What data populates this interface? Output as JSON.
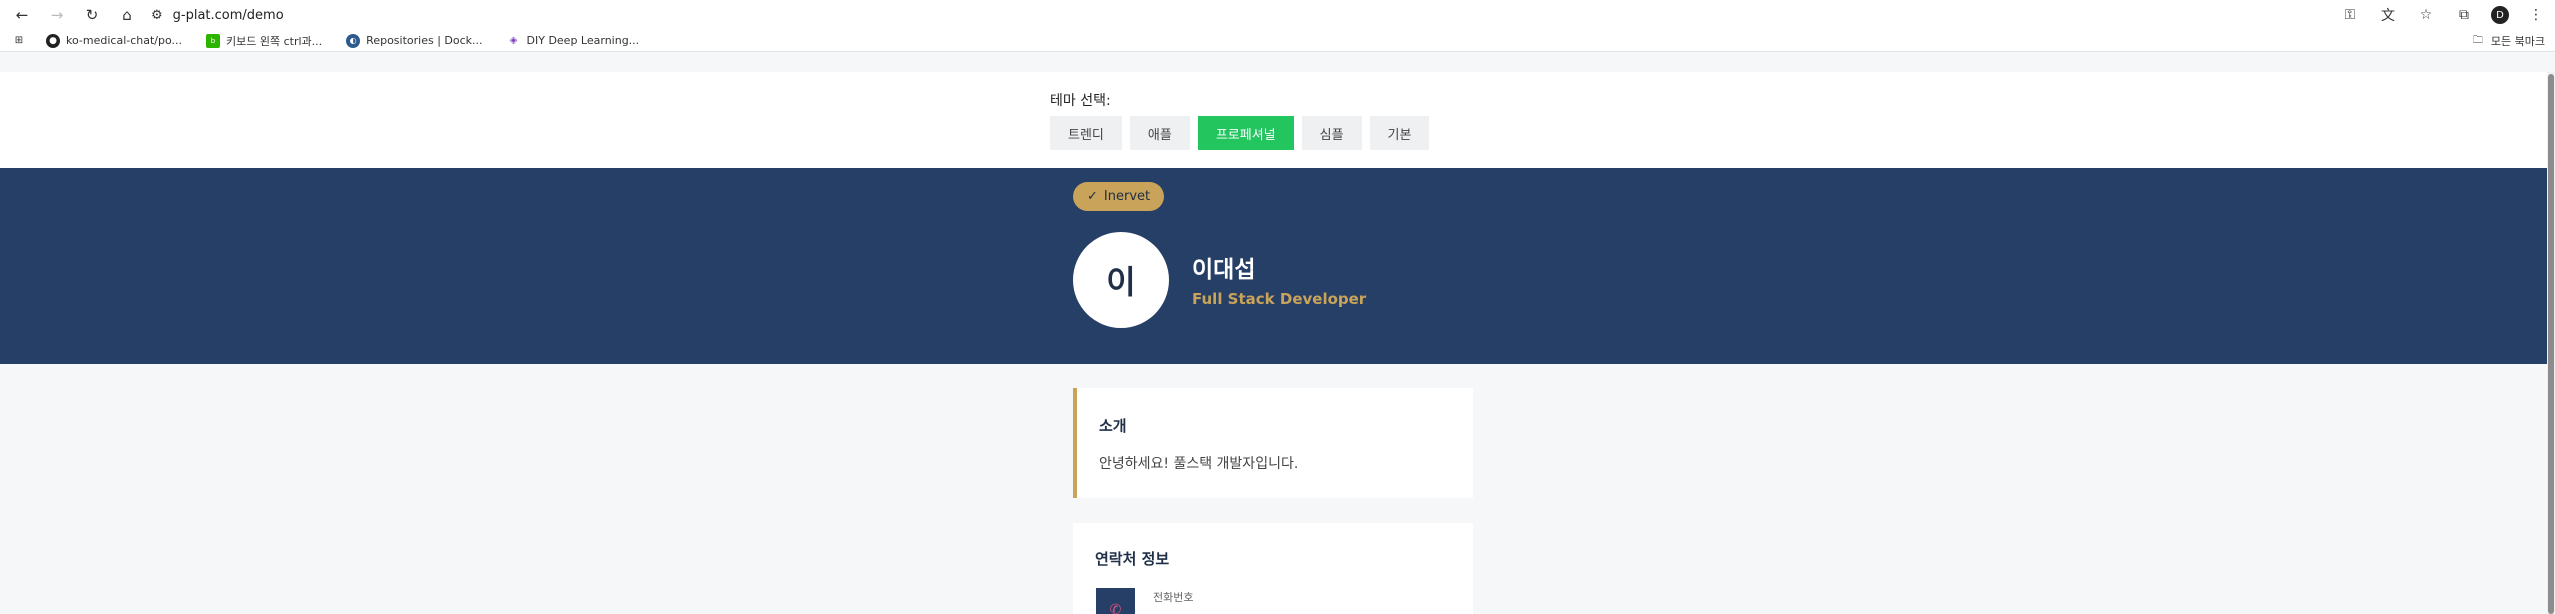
{
  "browser": {
    "url": "g-plat.com/demo",
    "avatar_letter": "D"
  },
  "bookmarks": {
    "items": [
      {
        "label": "ko-medical-chat/po...",
        "icon": "github-icon"
      },
      {
        "label": "키보드 왼쪽 ctrl과...",
        "icon": "naver-blog-icon"
      },
      {
        "label": "Repositories | Dock...",
        "icon": "docker-icon"
      },
      {
        "label": "DIY Deep Learning...",
        "icon": "globe-icon"
      }
    ],
    "all_label": "모든 북마크"
  },
  "theme": {
    "label": "테마 선택:",
    "buttons": [
      "트렌디",
      "애플",
      "프로페셔널",
      "심플",
      "기본"
    ],
    "active": "프로페셔널",
    "active_color": "#22c55e"
  },
  "profile": {
    "badge": "Inervet",
    "badge_check": "✓",
    "avatar_initial": "이",
    "name": "이대섭",
    "role": "Full Stack Developer",
    "hero_color": "#263f66",
    "accent_color": "#c9a35a"
  },
  "intro": {
    "title": "소개",
    "text": "안녕하세요! 풀스택 개발자입니다."
  },
  "contact": {
    "title": "연락처 정보",
    "phone_label": "전화번호"
  }
}
